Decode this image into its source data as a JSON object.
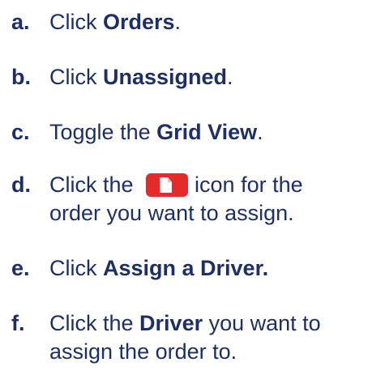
{
  "steps": [
    {
      "letter": "a.",
      "before": "Click ",
      "bold": "Orders",
      "after": "."
    },
    {
      "letter": "b.",
      "before": "Click ",
      "bold": "Unassigned",
      "after": "."
    },
    {
      "letter": "c.",
      "before": "Toggle the ",
      "bold": "Grid View",
      "after": "."
    },
    {
      "letter": "d.",
      "before": "Click the ",
      "icon": "document-icon",
      "after_line1": "icon for the",
      "line2": "order you want to assign."
    },
    {
      "letter": "e.",
      "before": "Click ",
      "bold": "Assign a Driver.",
      "after": ""
    },
    {
      "letter": "f.",
      "before": "Click the ",
      "bold": "Driver",
      "after": " you want to",
      "line2": "assign the order to."
    }
  ],
  "colors": {
    "text": "#1c2f6b",
    "icon_bg": "#e32b2b"
  }
}
